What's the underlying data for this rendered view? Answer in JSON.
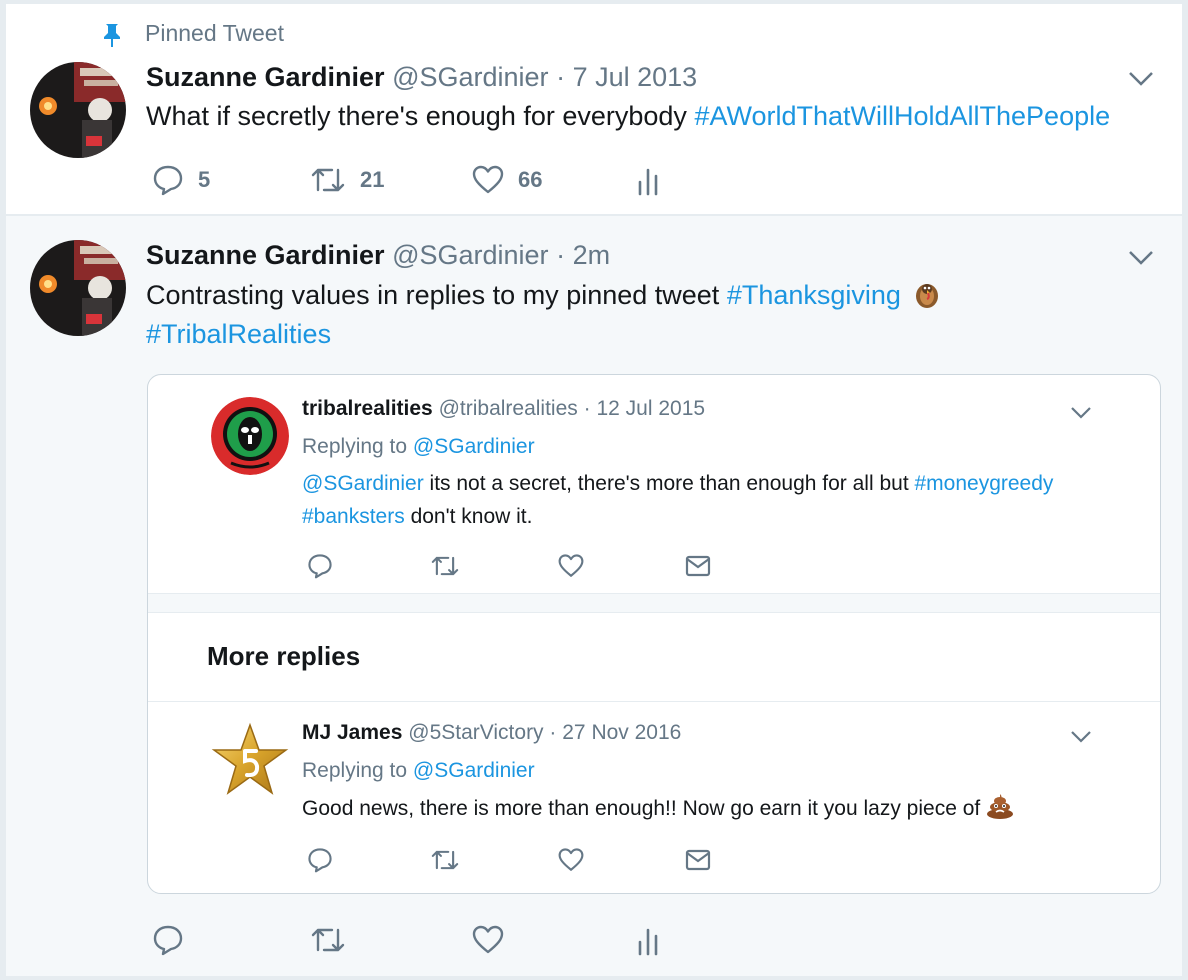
{
  "pinned_label": "Pinned Tweet",
  "tweet1": {
    "name": "Suzanne Gardinier",
    "handle": "@SGardinier",
    "dot": "·",
    "time": "7 Jul 2013",
    "text": "What if secretly there's enough for everybody ",
    "hashtag": "#AWorldThatWillHoldAllThePeople",
    "replies": "5",
    "retweets": "21",
    "likes": "66"
  },
  "tweet2": {
    "name": "Suzanne Gardinier",
    "handle": "@SGardinier",
    "dot": "·",
    "time": "2m",
    "text": "Contrasting values in replies to my pinned tweet ",
    "hashtag1": "#Thanksgiving",
    "hashtag2": "#TribalRealities"
  },
  "quote": {
    "reply1": {
      "name": "tribalrealities",
      "handle": "@tribalrealities",
      "dot": "·",
      "time": "12 Jul 2015",
      "replying_to_label": "Replying to ",
      "replying_to_handle": "@SGardinier",
      "mention": "@SGardinier",
      "text_a": " its not a secret, there's more than enough for all but ",
      "hashtag_a": "#moneygreedy",
      "hashtag_b": "#banksters",
      "text_b": " don't know it."
    },
    "more_replies": "More replies",
    "reply2": {
      "name": "MJ James",
      "handle": "@5StarVictory",
      "dot": "·",
      "time": "27 Nov 2016",
      "replying_to_label": "Replying to ",
      "replying_to_handle": "@SGardinier",
      "text": "Good news, there is more than enough!! Now go earn it you lazy piece of "
    }
  },
  "colors": {
    "link": "#1b95e0",
    "muted": "#657786",
    "background": "#e6ecf0",
    "card": "#ffffff",
    "highlight": "#f5f8fa"
  },
  "icons": [
    "pin-icon",
    "reply-icon",
    "retweet-icon",
    "like-icon",
    "analytics-icon",
    "message-icon",
    "chevron-down-icon",
    "turkey-emoji-icon",
    "poop-emoji-icon"
  ]
}
